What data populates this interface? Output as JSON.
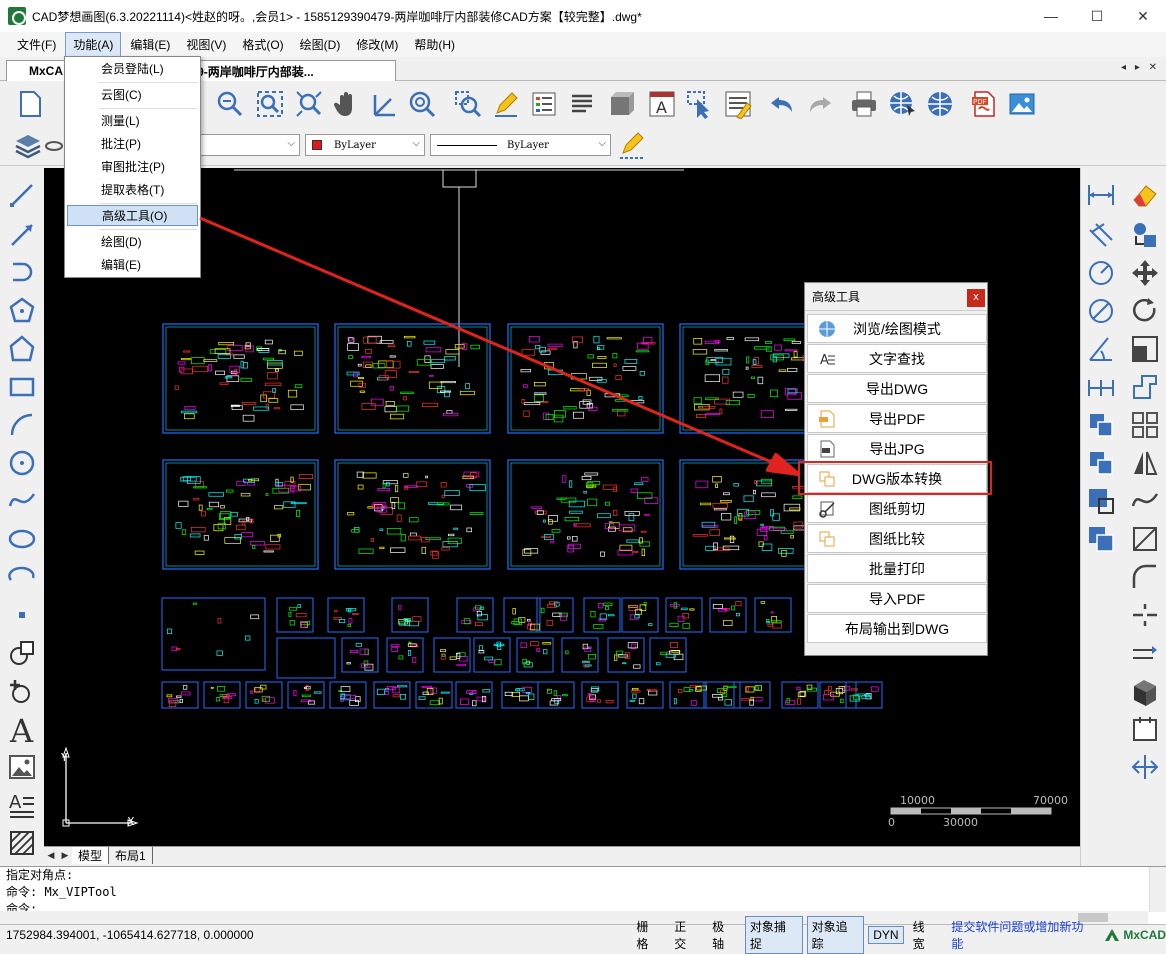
{
  "window": {
    "title": "CAD梦想画图(6.3.20221114)<姓赵的呀。,会员1> - 1585129390479-两岸咖啡厅内部装修CAD方案【较完整】.dwg*",
    "minimize": "—",
    "maximize": "☐",
    "close": "✕"
  },
  "menu": [
    "文件(F)",
    "功能(A)",
    "编辑(E)",
    "视图(V)",
    "格式(O)",
    "绘图(D)",
    "修改(M)",
    "帮助(H)"
  ],
  "tab": {
    "label": "MxCA",
    "title": "5129390479-两岸咖啡厅内部装...",
    "controls": "◂ ▸ ✕"
  },
  "function_menu": [
    "会员登陆(L)",
    "云图(C)",
    "测量(L)",
    "批注(P)",
    "审图批注(P)",
    "提取表格(T)",
    "高级工具(O)",
    "绘图(D)",
    "编辑(E)"
  ],
  "combos": {
    "color": "ByLayer",
    "linetype": "ByLayer"
  },
  "panel": {
    "title": "高级工具",
    "close": "x",
    "buttons": [
      "浏览/绘图模式",
      "文字查找",
      "导出DWG",
      "导出PDF",
      "导出JPG",
      "DWG版本转换",
      "图纸剪切",
      "图纸比较",
      "批量打印",
      "导入PDF",
      "布局输出到DWG"
    ]
  },
  "canvas": {
    "scale": {
      "top_left": "10000",
      "top_right": "70000",
      "bottom_left": "0",
      "bottom_mid": "30000"
    },
    "ucs": {
      "x": "X",
      "y": "Y"
    }
  },
  "sheets": [
    "模型",
    "布局1"
  ],
  "command": {
    "line1": "  指定对角点:",
    "line2": "命令: Mx_VIPTool",
    "line3": "命令:"
  },
  "status": {
    "coords": "1752984.394001,  -1065414.627718,  0.000000",
    "buttons": [
      {
        "label": "栅格",
        "on": false
      },
      {
        "label": "正交",
        "on": false
      },
      {
        "label": "极轴",
        "on": false
      },
      {
        "label": "对象捕捉",
        "on": true
      },
      {
        "label": "对象追踪",
        "on": true
      },
      {
        "label": "DYN",
        "on": true
      },
      {
        "label": "线宽",
        "on": false
      }
    ],
    "link": "提交软件问题或增加新功能",
    "brand": "MxCAD"
  },
  "colors": {
    "canvas": "#000000",
    "drawing_frame": "#1e6fff",
    "cyan": "#00e5ff",
    "highlight_red": "#e0231e",
    "brand_green": "#1f7a3a"
  }
}
